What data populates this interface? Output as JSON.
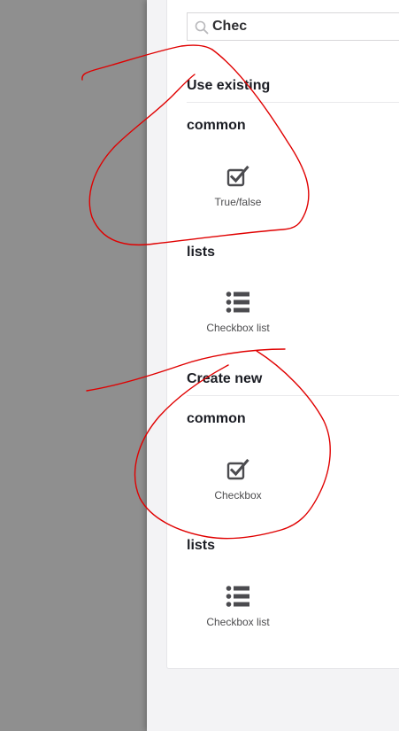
{
  "search": {
    "value": "Chec",
    "icon": "search-icon"
  },
  "sections": {
    "use_existing": {
      "title": "Use existing",
      "groups": {
        "common": {
          "title": "common",
          "tile": {
            "label": "True/false",
            "icon": "checkbox-icon"
          }
        },
        "lists": {
          "title": "lists",
          "tile": {
            "label": "Checkbox list",
            "icon": "list-icon"
          }
        }
      }
    },
    "create_new": {
      "title": "Create new",
      "groups": {
        "common": {
          "title": "common",
          "tile": {
            "label": "Checkbox",
            "icon": "checkbox-icon"
          }
        },
        "lists": {
          "title": "lists",
          "tile": {
            "label": "Checkbox list",
            "icon": "list-icon"
          }
        }
      }
    }
  },
  "colors": {
    "overlay": "#8f8f8f",
    "panel": "#f3f3f5",
    "card": "#ffffff",
    "icon": "#4b4b4f",
    "annotation": "#e00000"
  }
}
